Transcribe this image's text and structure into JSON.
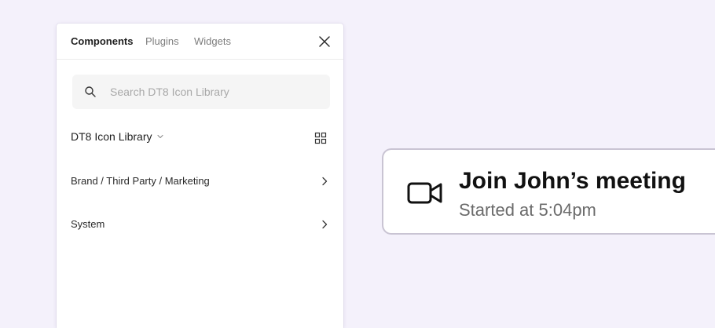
{
  "panel": {
    "tabs": [
      {
        "label": "Components",
        "active": true
      },
      {
        "label": "Plugins",
        "active": false
      },
      {
        "label": "Widgets",
        "active": false
      }
    ],
    "close_icon": "close-icon",
    "search": {
      "placeholder": "Search DT8 Icon Library",
      "value": "",
      "icon": "search-icon"
    },
    "library": {
      "title": "DT8 Icon Library",
      "dropdown_icon": "chevron-down-icon",
      "view_icon": "grid-view-icon"
    },
    "items": [
      {
        "label": "Brand / Third Party / Marketing",
        "icon": "chevron-right-icon"
      },
      {
        "label": "System",
        "icon": "chevron-right-icon"
      }
    ]
  },
  "meeting_card": {
    "icon": "video-camera-icon",
    "title": "Join John’s meeting",
    "subtitle": "Started at 5:04pm"
  },
  "colors": {
    "background": "#f4f1fb",
    "panel": "#ffffff",
    "card_border": "#c9c4d3",
    "text_primary": "#1e1e1e",
    "text_muted": "#7d7d7d"
  }
}
